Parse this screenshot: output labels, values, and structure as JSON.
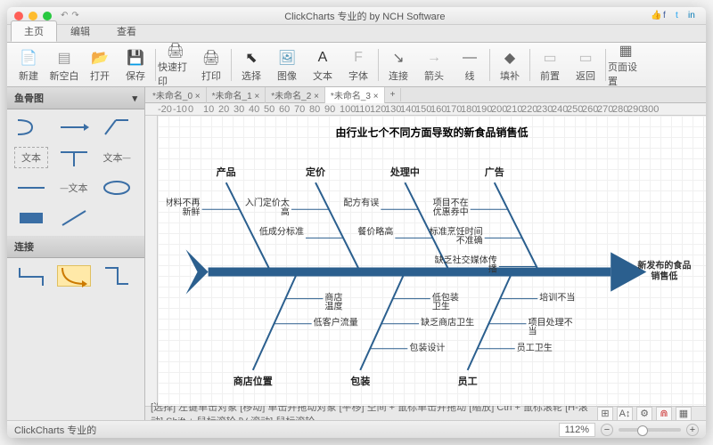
{
  "window_title": "ClickCharts 专业的 by NCH Software",
  "menu_tabs": [
    "主页",
    "编辑",
    "查看"
  ],
  "active_menu_tab": 0,
  "toolbar": [
    {
      "label": "新建",
      "icon": "📄",
      "color": "#5b9"
    },
    {
      "label": "新空白",
      "icon": "▤",
      "color": "#999"
    },
    {
      "label": "打开",
      "icon": "📂",
      "color": "#e8b030"
    },
    {
      "label": "保存",
      "icon": "💾",
      "color": "#7a5"
    },
    {
      "sep": true
    },
    {
      "label": "快速打印",
      "icon": "🖨",
      "color": "#666"
    },
    {
      "label": "打印",
      "icon": "🖨",
      "color": "#666"
    },
    {
      "sep": true
    },
    {
      "label": "选择",
      "icon": "⬉",
      "color": "#333"
    },
    {
      "label": "图像",
      "icon": "🖼",
      "color": "#59b"
    },
    {
      "label": "文本",
      "icon": "A",
      "color": "#333"
    },
    {
      "label": "字体",
      "icon": "F",
      "color": "#bbb"
    },
    {
      "sep": true
    },
    {
      "label": "连接",
      "icon": "↘",
      "color": "#666"
    },
    {
      "label": "箭头",
      "icon": "→",
      "color": "#bbb"
    },
    {
      "label": "线",
      "icon": "—",
      "color": "#666"
    },
    {
      "sep": true
    },
    {
      "label": "填补",
      "icon": "◆",
      "color": "#666"
    },
    {
      "sep": true
    },
    {
      "label": "前置",
      "icon": "▭",
      "color": "#bbb"
    },
    {
      "label": "返回",
      "icon": "▭",
      "color": "#bbb"
    },
    {
      "sep": true
    },
    {
      "label": "页面设置",
      "icon": "▦",
      "color": "#666"
    }
  ],
  "sidebar": {
    "shapes_title": "鱼骨图",
    "connections_title": "连接",
    "text_label": "文本"
  },
  "doc_tabs": [
    "*未命名_0",
    "*未命名_1",
    "*未命名_2",
    "*未命名_3"
  ],
  "active_doc_tab": 3,
  "chart_data": {
    "type": "fishbone",
    "title": "由行业七个不同方面导致的新食品销售低",
    "effect": "新发布的食品\n销售低",
    "categories_top": [
      {
        "name": "产品",
        "causes": [
          "原材料不再\n新鲜"
        ]
      },
      {
        "name": "定价",
        "causes": [
          "入门定价太\n高",
          "低成分标准"
        ]
      },
      {
        "name": "处理中",
        "causes": [
          "配方有误",
          "餐价略高"
        ]
      },
      {
        "name": "广告",
        "causes": [
          "项目不在\n优惠券中",
          "标准烹饪时间\n不准确",
          "缺乏社交媒体传\n播"
        ]
      }
    ],
    "categories_bottom": [
      {
        "name": "商店位置",
        "causes": [
          "商店\n温度",
          "低客户流量"
        ]
      },
      {
        "name": "包装",
        "causes": [
          "低包装\n卫生",
          "缺乏商店卫生",
          "包装设计"
        ]
      },
      {
        "name": "员工",
        "causes": [
          "培训不当",
          "项目处理不\n当",
          "员工卫生"
        ]
      }
    ]
  },
  "ruler_marks": [
    -20,
    -10,
    0,
    10,
    20,
    30,
    40,
    50,
    60,
    70,
    80,
    90,
    100,
    110,
    120,
    130,
    140,
    150,
    160,
    170,
    180,
    190,
    200,
    210,
    220,
    230,
    240,
    250,
    260,
    270,
    280,
    290,
    300
  ],
  "status_text": "[选择] 左键单击对象 [移动] 单击并拖动对象 [平移] 空间 + 鼠标单击并拖动 [缩放] Ctrl + 鼠标滚轮 [H-滚动] Shift + 鼠标滚轮 [V-滚动] 鼠标滚轮",
  "footer_text": "ClickCharts 专业的",
  "zoom": "112%"
}
